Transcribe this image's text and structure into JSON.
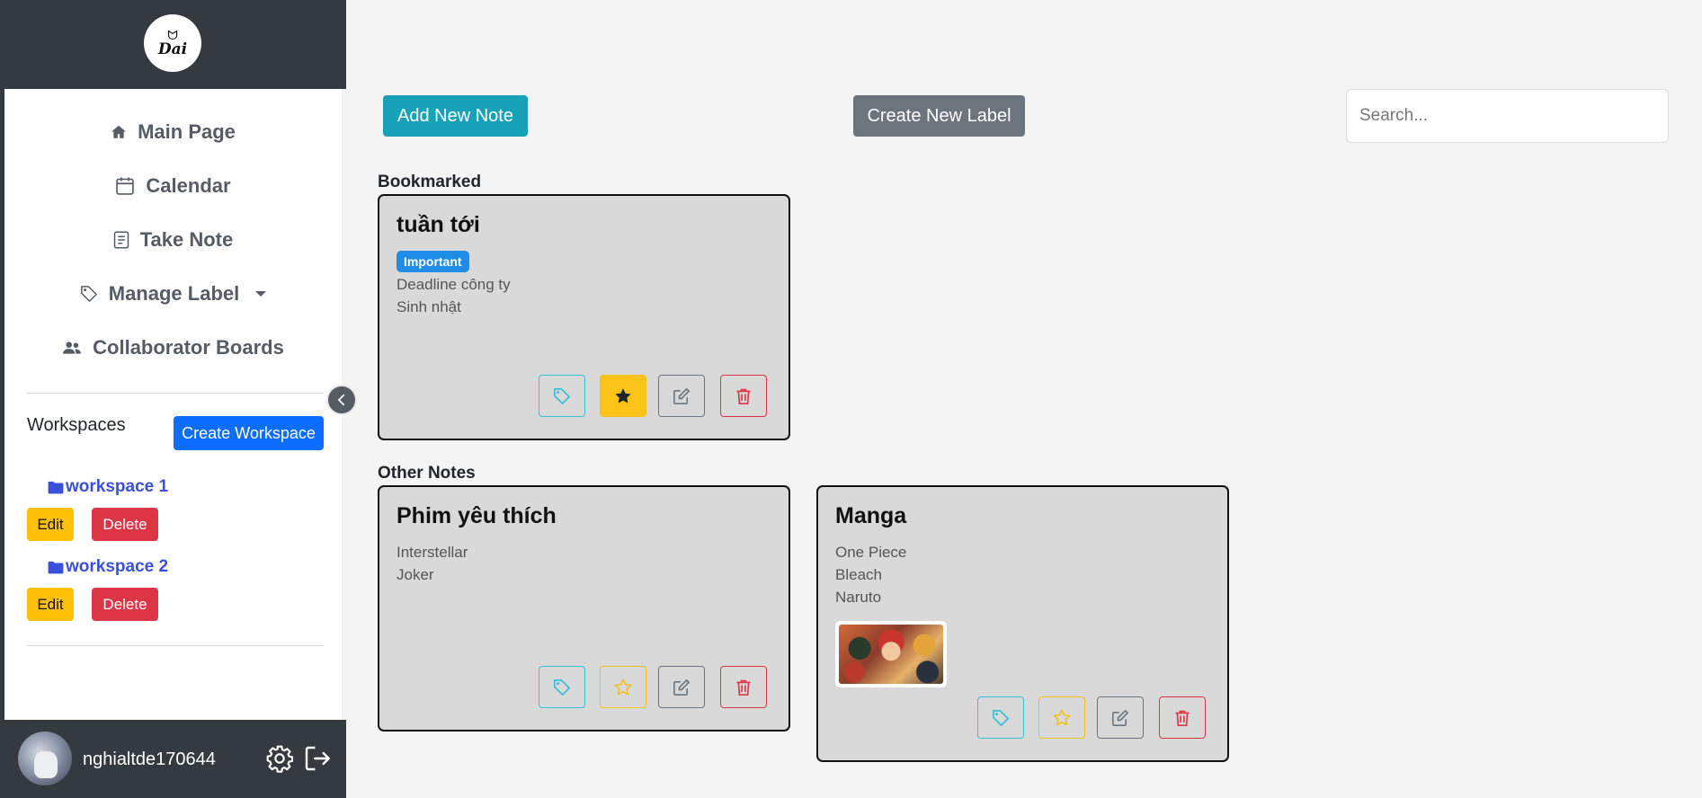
{
  "sidebar": {
    "logo_text": "Dai",
    "nav": [
      {
        "label": "Main Page",
        "icon": "home-icon"
      },
      {
        "label": "Calendar",
        "icon": "calendar-icon"
      },
      {
        "label": "Take Note",
        "icon": "note-icon"
      },
      {
        "label": "Manage Label",
        "icon": "tag-icon"
      },
      {
        "label": "Collaborator Boards",
        "icon": "users-icon"
      }
    ],
    "workspaces_title": "Workspaces",
    "create_workspace_label": "Create Workspace",
    "workspaces": [
      {
        "name": "workspace 1",
        "edit_label": "Edit",
        "delete_label": "Delete"
      },
      {
        "name": "workspace 2",
        "edit_label": "Edit",
        "delete_label": "Delete"
      }
    ],
    "footer": {
      "username": "nghialtde170644"
    }
  },
  "toolbar": {
    "add_note_label": "Add New Note",
    "create_label_label": "Create New Label",
    "search_placeholder": "Search..."
  },
  "sections": {
    "bookmarked_title": "Bookmarked",
    "other_title": "Other Notes"
  },
  "notes": {
    "bookmarked": [
      {
        "title": "tuần tới",
        "label": "Important",
        "lines": [
          "Deadline công ty",
          "Sinh nhật"
        ],
        "starred": true
      }
    ],
    "other": [
      {
        "title": "Phim yêu thích",
        "lines": [
          "Interstellar",
          "Joker"
        ],
        "starred": false
      },
      {
        "title": "Manga",
        "lines": [
          "One Piece",
          "Bleach",
          "Naruto"
        ],
        "starred": false,
        "has_image": true
      }
    ]
  },
  "colors": {
    "sidebar_dark": "#343a40",
    "primary": "#0d6efd",
    "info": "#17a2b8",
    "secondary": "#6c757d",
    "warning": "#ffc107",
    "danger": "#dc3545",
    "label_badge": "#1f8de8",
    "card_bg": "#d9d9d9"
  }
}
